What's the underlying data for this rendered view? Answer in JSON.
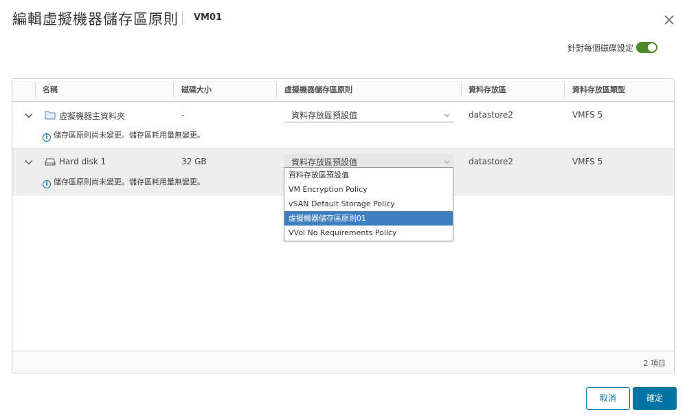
{
  "header": {
    "title": "編輯虛擬機器儲存區原則",
    "vm_name": "VM01"
  },
  "options": {
    "per_disk_label": "針對每個磁碟設定",
    "per_disk_enabled": true
  },
  "grid": {
    "columns": [
      "名稱",
      "磁碟大小",
      "虛擬機器儲存區原則",
      "資料存放區",
      "資料存放區類型"
    ],
    "rows": [
      {
        "name": "虛擬機器主資料夾",
        "icon": "folder-icon",
        "size": "-",
        "policy": "資料存放區預設值",
        "datastore": "datastore2",
        "datastore_type": "VMFS 5",
        "info": "儲存區原則尚未變更。儲存區耗用量無變更。"
      },
      {
        "name": "Hard disk 1",
        "icon": "hard-disk-icon",
        "size": "32 GB",
        "policy": "資料存放區預設值",
        "datastore": "datastore2",
        "datastore_type": "VMFS 5",
        "info": "儲存區原則尚未變更。儲存區耗用量無變更。"
      }
    ],
    "dropdown_options": [
      "資料存放區預設值",
      "VM Encryption Policy",
      "vSAN Default Storage Policy",
      "虛擬機器儲存區原則01",
      "VVol No Requirements Policy"
    ],
    "dropdown_selected_index": 3,
    "footer_count": "2 項目"
  },
  "buttons": {
    "cancel": "取消",
    "ok": "確定"
  },
  "colors": {
    "accent": "#0072a3",
    "toggle_on": "#4c8a25",
    "selected_option": "#3e7fc1"
  }
}
